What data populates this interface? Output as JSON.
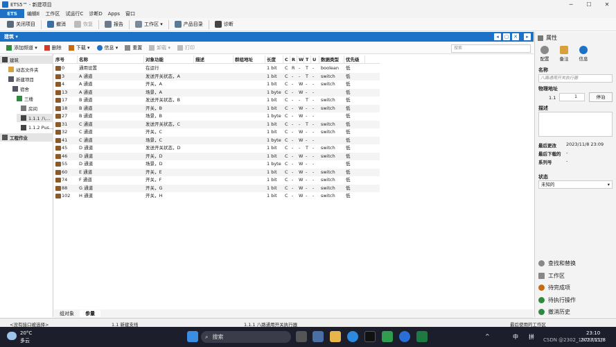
{
  "window": {
    "title": "ETS5™ - 新建项目",
    "controls": [
      "─",
      "☐",
      "✕"
    ]
  },
  "menu": {
    "brand": "ETS",
    "items": [
      "编辑E",
      "工作区",
      "试运行C",
      "诊断D",
      "Apps",
      "窗口"
    ]
  },
  "toolbar": {
    "items": [
      {
        "label": "关闭项目",
        "icon": "close-project-icon",
        "disabled": false
      },
      {
        "label": "撤消",
        "icon": "undo-icon",
        "disabled": false
      },
      {
        "label": "恢复",
        "icon": "redo-icon",
        "disabled": true
      },
      {
        "label": "报告",
        "icon": "report-icon",
        "disabled": false
      },
      {
        "label": "工作区 ▾",
        "icon": "workspace-icon",
        "disabled": false
      },
      {
        "label": "产品目录",
        "icon": "catalog-icon",
        "disabled": false
      },
      {
        "label": "诊断",
        "icon": "diagnostics-icon",
        "disabled": false
      }
    ]
  },
  "panel": {
    "title": "建筑 ▾",
    "btns": [
      "◂",
      "▢",
      "✕",
      "▸"
    ]
  },
  "subtool": {
    "items": [
      {
        "label": "添加频道 ▾",
        "disabled": false,
        "color": "#2e8b3e"
      },
      {
        "label": "删除",
        "disabled": false,
        "color": "#d23b2b"
      },
      {
        "label": "下载 ▾",
        "disabled": false,
        "color": "#c86a10"
      },
      {
        "label": "信息 ▾",
        "disabled": false,
        "color": "#1d72c8"
      },
      {
        "label": "重置",
        "disabled": false,
        "color": "#888"
      },
      {
        "label": "卸载 ▾",
        "disabled": true,
        "color": "#bbb"
      },
      {
        "label": "打印",
        "disabled": true,
        "color": "#bbb"
      }
    ],
    "search_placeholder": "搜索"
  },
  "tree": {
    "items": [
      {
        "label": "建筑",
        "color": "#444",
        "selected": true
      },
      {
        "label": "动态文件夹",
        "color": "#d9a13a",
        "selected": false
      },
      {
        "label": "新建项目",
        "color": "#556",
        "selected": false
      },
      {
        "label": "宿舍",
        "color": "#556",
        "selected": false
      },
      {
        "label": "三楼",
        "color": "#2e8b3e",
        "selected": false
      },
      {
        "label": "房间",
        "color": "#777",
        "selected": false
      },
      {
        "label": "1.1.1 八...",
        "color": "#444",
        "selected": true
      },
      {
        "label": "1.1.2 Pus...",
        "color": "#444",
        "selected": false
      },
      {
        "label": "工程作业",
        "color": "#555",
        "selected": true
      }
    ]
  },
  "table": {
    "columns": [
      "序号",
      "名称",
      "对象功能",
      "描述",
      "群组地址",
      "长度",
      "C",
      "R",
      "W",
      "T",
      "U",
      "数据类型",
      "优先级"
    ],
    "rows": [
      [
        "0",
        "通用设置",
        "在运行",
        "",
        "",
        "1 bit",
        "C",
        "R",
        "-",
        "T",
        "-",
        "boolean",
        "低"
      ],
      [
        "3",
        "A 通道",
        "发送开关状态，A",
        "",
        "",
        "1 bit",
        "C",
        "-",
        "-",
        "T",
        "-",
        "switch",
        "低"
      ],
      [
        "4",
        "A 通道",
        "开关，A",
        "",
        "",
        "1 bit",
        "C",
        "-",
        "W",
        "-",
        "-",
        "switch",
        "低"
      ],
      [
        "13",
        "A 通道",
        "场景，A",
        "",
        "",
        "1 byte",
        "C",
        "-",
        "W",
        "-",
        "-",
        "",
        "低"
      ],
      [
        "17",
        "B 通道",
        "发送开关状态，B",
        "",
        "",
        "1 bit",
        "C",
        "-",
        "-",
        "T",
        "-",
        "switch",
        "低"
      ],
      [
        "18",
        "B 通道",
        "开关，B",
        "",
        "",
        "1 bit",
        "C",
        "-",
        "W",
        "-",
        "-",
        "switch",
        "低"
      ],
      [
        "27",
        "B 通道",
        "场景，B",
        "",
        "",
        "1 byte",
        "C",
        "-",
        "W",
        "-",
        "-",
        "",
        "低"
      ],
      [
        "31",
        "C 通道",
        "发送开关状态，C",
        "",
        "",
        "1 bit",
        "C",
        "-",
        "-",
        "T",
        "-",
        "switch",
        "低"
      ],
      [
        "32",
        "C 通道",
        "开关，C",
        "",
        "",
        "1 bit",
        "C",
        "-",
        "W",
        "-",
        "-",
        "switch",
        "低"
      ],
      [
        "41",
        "C 通道",
        "场景，C",
        "",
        "",
        "1 byte",
        "C",
        "-",
        "W",
        "-",
        "-",
        "",
        "低"
      ],
      [
        "45",
        "D 通道",
        "发送开关状态，D",
        "",
        "",
        "1 bit",
        "C",
        "-",
        "-",
        "T",
        "-",
        "switch",
        "低"
      ],
      [
        "46",
        "D 通道",
        "开关，D",
        "",
        "",
        "1 bit",
        "C",
        "-",
        "W",
        "-",
        "-",
        "switch",
        "低"
      ],
      [
        "55",
        "D 通道",
        "场景，D",
        "",
        "",
        "1 byte",
        "C",
        "-",
        "W",
        "-",
        "-",
        "",
        "低"
      ],
      [
        "60",
        "E 通道",
        "开关，E",
        "",
        "",
        "1 bit",
        "C",
        "-",
        "W",
        "-",
        "-",
        "switch",
        "低"
      ],
      [
        "74",
        "F 通道",
        "开关，F",
        "",
        "",
        "1 bit",
        "C",
        "-",
        "W",
        "-",
        "-",
        "switch",
        "低"
      ],
      [
        "88",
        "G 通道",
        "开关，G",
        "",
        "",
        "1 bit",
        "C",
        "-",
        "W",
        "-",
        "-",
        "switch",
        "低"
      ],
      [
        "102",
        "H 通道",
        "开关，H",
        "",
        "",
        "1 bit",
        "C",
        "-",
        "W",
        "-",
        "-",
        "switch",
        "低"
      ]
    ]
  },
  "bottom_tabs": [
    "组对象",
    "参量"
  ],
  "props": {
    "title": "属性",
    "tabs": [
      {
        "label": "配置",
        "color": "#8a8a8a"
      },
      {
        "label": "备注",
        "color": "#d9a13a"
      },
      {
        "label": "信息",
        "color": "#1d72c8"
      }
    ],
    "name_label": "名称",
    "name_placeholder": "八路通用开关执行器",
    "addr_label": "物理地址",
    "addr_prefix": "1.1",
    "addr_value": "1",
    "park_btn": "停泊",
    "desc_label": "描述",
    "info": [
      {
        "k": "最后更改",
        "v": "2023/11/8 23:09"
      },
      {
        "k": "最后下载的",
        "v": "-"
      },
      {
        "k": "系列号",
        "v": "-"
      }
    ],
    "status_label": "状态",
    "status_value": "未知的",
    "links": [
      {
        "label": "查找和替换",
        "color": "#888"
      },
      {
        "label": "工作区",
        "color": "#888"
      },
      {
        "label": "待完成项",
        "color": "#c86a10"
      },
      {
        "label": "待执行操作",
        "color": "#2e8b3e"
      },
      {
        "label": "撤消历史",
        "color": "#2e8b3e"
      }
    ]
  },
  "statusbar": {
    "left": "<没有接口被选择>",
    "mid1": "1.1 新建支线",
    "mid2": "1.1.1 八路通用开关执行器",
    "right": "最后使用的工作区"
  },
  "taskbar": {
    "weather_temp": "20°C",
    "weather_desc": "多云",
    "search": "搜索",
    "ime1": "中",
    "ime2": "拼",
    "time": "23:10",
    "date": "2023/11/8",
    "watermark": "CSDN @2302_15757751"
  }
}
